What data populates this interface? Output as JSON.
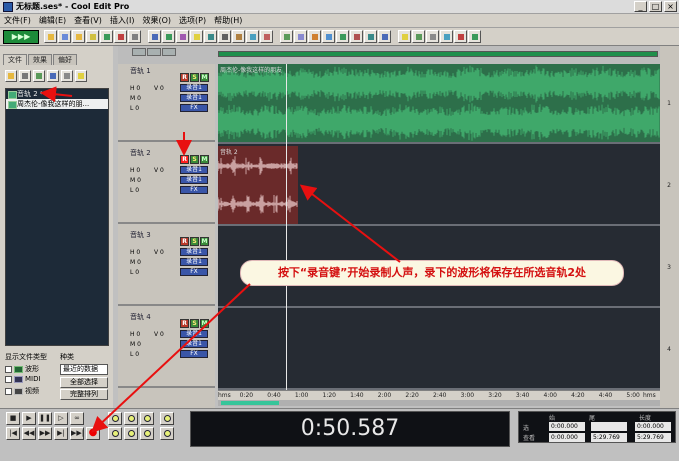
{
  "window": {
    "title": "无标题.ses* - Cool Edit Pro",
    "controls": [
      "_",
      "□",
      "×"
    ]
  },
  "menu": [
    "文件(F)",
    "编辑(E)",
    "查看(V)",
    "插入(I)",
    "效果(O)",
    "选项(P)",
    "帮助(H)"
  ],
  "left_panel": {
    "tabs": [
      "文件",
      "效果",
      "偏好"
    ],
    "files": [
      "音轨  2 *",
      "周杰伦-像我这样的朋..."
    ],
    "file_type_label": "显示文件类型",
    "sort_label": "种类",
    "types": [
      "波形",
      "MIDI",
      "视频"
    ],
    "sort_value": "最近的数据",
    "buttons": [
      "全部选择",
      "完整排列"
    ]
  },
  "tracks": [
    {
      "name": "音轨 1",
      "h": "H 0",
      "v": "V 0",
      "m": "M 0",
      "l": "L 0",
      "btn1": "录音1",
      "btn2": "录音1",
      "btn3": "FX"
    },
    {
      "name": "音轨 2",
      "h": "H 0",
      "v": "V 0",
      "m": "M 0",
      "l": "L 0",
      "btn1": "录音1",
      "btn2": "录音1",
      "btn3": "FX"
    },
    {
      "name": "音轨 3",
      "h": "H 0",
      "v": "V 0",
      "m": "M 0",
      "l": "L 0",
      "btn1": "录音1",
      "btn2": "录音1",
      "btn3": "FX"
    },
    {
      "name": "音轨 4",
      "h": "H 0",
      "v": "V 0",
      "m": "M 0",
      "l": "L 0",
      "btn1": "录音1",
      "btn2": "录音1",
      "btn3": "FX"
    }
  ],
  "rsm_labels": {
    "r": "R",
    "s": "S",
    "m": "M"
  },
  "lane_numbers": [
    "1",
    "2",
    "3",
    "4"
  ],
  "clips": {
    "track1_label": "周杰伦-像我这样的朋友",
    "track2_label": "音轨 2"
  },
  "ruler": {
    "labels": [
      "hms",
      "0:20",
      "0:40",
      "1:00",
      "1:20",
      "1:40",
      "2:00",
      "2:20",
      "2:40",
      "3:00",
      "3:20",
      "3:40",
      "4:00",
      "4:20",
      "4:40",
      "5:00",
      "hms"
    ]
  },
  "transport": {
    "time": "0:50.587"
  },
  "info": {
    "headers": [
      "始",
      "尾",
      "长度"
    ],
    "rows": [
      {
        "label": "选",
        "values": [
          "0:00.000",
          "",
          "0:00.000"
        ]
      },
      {
        "label": "查看",
        "values": [
          "0:00.000",
          "5:29.769",
          "5:29.769"
        ]
      }
    ]
  },
  "annotation": {
    "text": "按下“录音键”开始录制人声，录下的波形将保存在所选音轨2处"
  },
  "colors": {
    "track1_wave": "#3fa86a",
    "track2_wave": "#7a3a3a",
    "record_red": "#e00000",
    "arrow_red": "#e81010"
  }
}
